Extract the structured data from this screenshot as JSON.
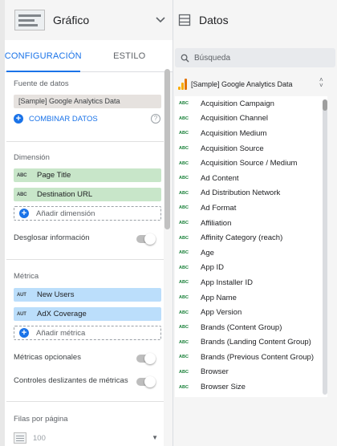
{
  "left_panel": {
    "chart_type_label": "Gráfico",
    "tabs": [
      {
        "label": "CONFIGURACIÓN",
        "active": true
      },
      {
        "label": "ESTILO",
        "active": false
      }
    ],
    "data_source": {
      "label": "Fuente de datos",
      "value": "[Sample] Google Analytics Data",
      "combine_label": "COMBINAR DATOS",
      "help_glyph": "?"
    },
    "dimension": {
      "label": "Dimensión",
      "items": [
        {
          "type": "ABC",
          "label": "Page Title"
        },
        {
          "type": "ABC",
          "label": "Destination URL"
        }
      ],
      "add_label": "Añadir dimensión"
    },
    "drilldown_label": "Desglosar información",
    "metric": {
      "label": "Métrica",
      "items": [
        {
          "type": "AUT",
          "label": "New Users"
        },
        {
          "type": "AUT",
          "label": "AdX Coverage"
        }
      ],
      "add_label": "Añadir métrica"
    },
    "optional_metrics_label": "Métricas opcionales",
    "metric_sliders_label": "Controles deslizantes de métricas",
    "rows_per_page": {
      "label": "Filas por página",
      "value": "100"
    }
  },
  "right_panel": {
    "title": "Datos",
    "search_placeholder": "Búsqueda",
    "data_source_name": "[Sample] Google Analytics Data",
    "fields": [
      {
        "type": "ABC",
        "label": "Acquisition Campaign"
      },
      {
        "type": "ABC",
        "label": "Acquisition Channel"
      },
      {
        "type": "ABC",
        "label": "Acquisition Medium"
      },
      {
        "type": "ABC",
        "label": "Acquisition Source"
      },
      {
        "type": "ABC",
        "label": "Acquisition Source / Medium"
      },
      {
        "type": "ABC",
        "label": "Ad Content"
      },
      {
        "type": "ABC",
        "label": "Ad Distribution Network"
      },
      {
        "type": "ABC",
        "label": "Ad Format"
      },
      {
        "type": "ABC",
        "label": "Affiliation"
      },
      {
        "type": "ABC",
        "label": "Affinity Category (reach)"
      },
      {
        "type": "ABC",
        "label": "Age"
      },
      {
        "type": "ABC",
        "label": "App ID"
      },
      {
        "type": "ABC",
        "label": "App Installer ID"
      },
      {
        "type": "ABC",
        "label": "App Name"
      },
      {
        "type": "ABC",
        "label": "App Version"
      },
      {
        "type": "ABC",
        "label": "Brands (Content Group)"
      },
      {
        "type": "ABC",
        "label": "Brands (Landing Content Group)"
      },
      {
        "type": "ABC",
        "label": "Brands (Previous Content Group)"
      },
      {
        "type": "ABC",
        "label": "Browser"
      },
      {
        "type": "ABC",
        "label": "Browser Size"
      }
    ]
  },
  "colors": {
    "accent": "#1a73e8",
    "dimension_chip": "#c8e6c9",
    "metric_chip": "#bbdefb",
    "field_type": "#188038"
  }
}
